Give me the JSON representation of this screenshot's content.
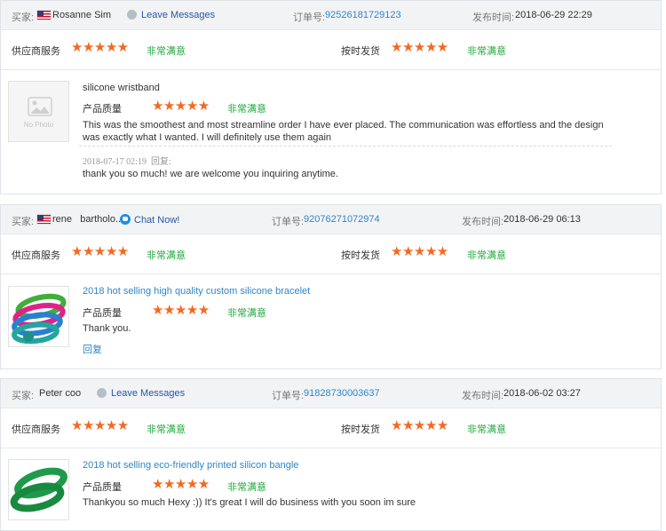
{
  "labels": {
    "buyer": "买家:",
    "order_no": "订单号:",
    "published": "发布时间:",
    "supplier_service": "供应商服务",
    "on_time_delivery": "按时发货",
    "product_quality": "产品质量",
    "very_satisfied": "非常满意",
    "stars": "★★★★★",
    "reply_label": "回复:",
    "reply_link": "回复",
    "no_photo": "No Photo"
  },
  "colors": {
    "star": "#f5681f",
    "satisfied": "#1fa83d",
    "link": "#2f86c9",
    "header_bg": "#f2f3f5"
  },
  "reviews": [
    {
      "buyer": "Rosanne Sim",
      "flag": "us-flag",
      "contact": "Leave Messages",
      "contact_icon": "message-icon",
      "order_no": "92526181729123",
      "time": "2018-06-29 22:29",
      "product": "silicone wristband",
      "comment": "This was the smoothest and most streamline order I have ever placed. The communication was effortless and the design was exactly what I wanted. I will definitely use them again",
      "reply_time": "2018-07-17 02:19",
      "reply": "thank you so much! we are welcome you inquiring anytime."
    },
    {
      "buyer_first": "rene",
      "buyer_last": "bartholo...",
      "flag": "us-flag",
      "contact": "Chat Now!",
      "contact_icon": "chat-icon",
      "order_no": "92076271072974",
      "time": "2018-06-29 06:13",
      "product": "2018 hot selling high quality custom silicone bracelet",
      "comment": "Thank you."
    },
    {
      "buyer": "Peter coo",
      "contact": "Leave Messages",
      "contact_icon": "message-icon",
      "order_no": "91828730003637",
      "time": "2018-06-02 03:27",
      "product": "2018 hot selling eco-friendly printed silicon bangle",
      "comment": "Thankyou so much Hexy :)) It's great I will do business with you soon im sure"
    }
  ]
}
